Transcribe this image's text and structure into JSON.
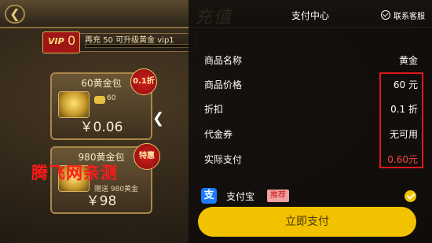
{
  "game": {
    "back_symbol": "❮",
    "title_decoration": "充值",
    "vip": {
      "label": "VIP",
      "level": "0",
      "tip": "再充 50 可升级黄金 vip1",
      "progress_fraction": 0
    },
    "packs": [
      {
        "title": "60黄金包",
        "amount": "60",
        "gift": "",
        "price": "￥0.06",
        "tag": "0.1折"
      },
      {
        "title": "980黄金包",
        "amount": "",
        "gift": "赠送 980黄金",
        "price": "￥98",
        "tag": "特惠"
      }
    ],
    "watermark": "腾飞网亲测"
  },
  "payment": {
    "title": "支付中心",
    "service_label": "联系客服",
    "collapse_symbol": "❮",
    "rows": [
      {
        "label": "商品名称",
        "value": "黄金"
      },
      {
        "label": "商品价格",
        "value": "60 元"
      },
      {
        "label": "折扣",
        "value": "0.1 折"
      },
      {
        "label": "代金券",
        "value": "无可用"
      },
      {
        "label": "实际支付",
        "value": "0.60元"
      }
    ],
    "method": {
      "icon_glyph": "支",
      "label": "支付宝",
      "badge": "推荐"
    },
    "pay_button": "立即支付",
    "colors": {
      "accent": "#f2c200",
      "discount_red": "#ff4646",
      "highlight_red": "#e01818",
      "alipay_blue": "#1a7bff"
    }
  }
}
